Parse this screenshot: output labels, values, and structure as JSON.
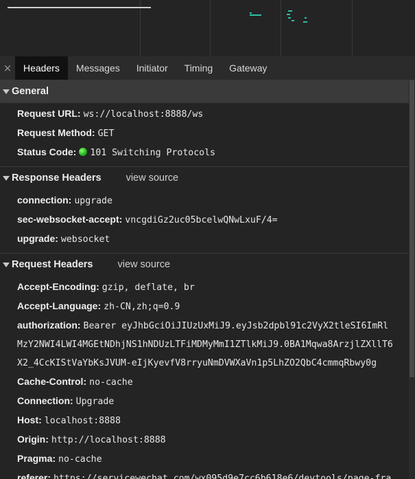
{
  "tabs": [
    "Headers",
    "Messages",
    "Initiator",
    "Timing",
    "Gateway"
  ],
  "active_tab": "Headers",
  "general": {
    "title": "General",
    "request_url_label": "Request URL:",
    "request_url": "ws://localhost:8888/ws",
    "request_method_label": "Request Method:",
    "request_method": "GET",
    "status_code_label": "Status Code:",
    "status_code": "101 Switching Protocols",
    "status_color": "#1fae1f"
  },
  "response_headers": {
    "title": "Response Headers",
    "view_source": "view source",
    "items": [
      {
        "k": "connection:",
        "v": "upgrade"
      },
      {
        "k": "sec-websocket-accept:",
        "v": "vncgdiGz2uc05bcelwQNwLxuF/4="
      },
      {
        "k": "upgrade:",
        "v": "websocket"
      }
    ]
  },
  "request_headers": {
    "title": "Request Headers",
    "view_source": "view source",
    "accept_encoding_label": "Accept-Encoding:",
    "accept_encoding": "gzip, deflate, br",
    "accept_language_label": "Accept-Language:",
    "accept_language": "zh-CN,zh;q=0.9",
    "authorization_label": "authorization:",
    "authorization_line1": "Bearer eyJhbGciOiJIUzUxMiJ9.eyJsb2dpbl91c2VyX2tleSI6ImRl",
    "authorization_line2": "MzY2NWI4LWI4MGEtNDhjNS1hNDUzLTFiMDMyMmI1ZTlkMiJ9.0BA1Mqwa8ArzjlZXllT6",
    "authorization_line3": "X2_4CcKIStVaYbKsJVUM-eIjKyevfV8rryuNmDVWXaVn1p5LhZO2QbC4cmmqRbwy0g",
    "cache_control_label": "Cache-Control:",
    "cache_control": "no-cache",
    "connection_label": "Connection:",
    "connection": "Upgrade",
    "host_label": "Host:",
    "host": "localhost:8888",
    "origin_label": "Origin:",
    "origin": "http://localhost:8888",
    "pragma_label": "Pragma:",
    "pragma": "no-cache",
    "referer_label": "referer:",
    "referer": "https://servicewechat.com/wx095d9e7cc6b618e6/devtools/page-fra"
  },
  "icons": {
    "close": "×"
  }
}
